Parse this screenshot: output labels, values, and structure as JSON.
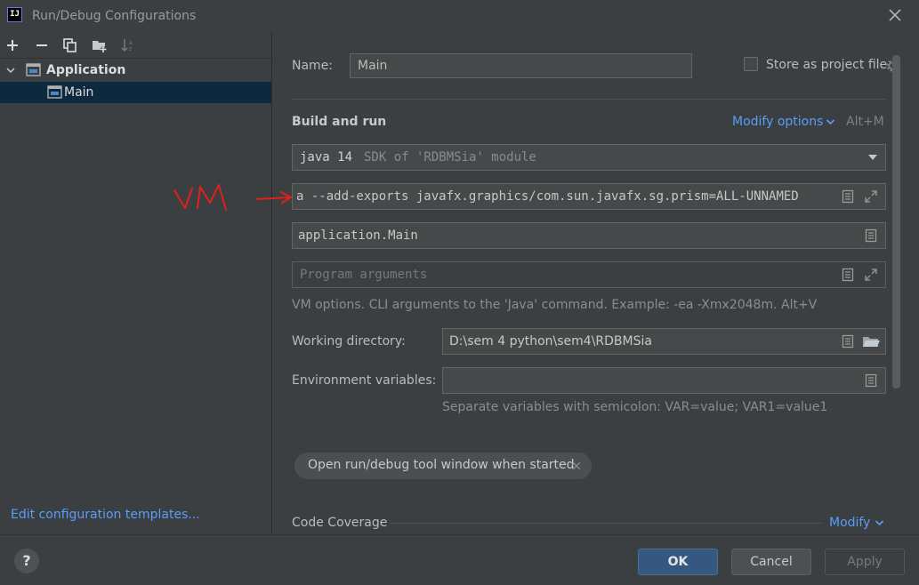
{
  "window": {
    "title": "Run/Debug Configurations",
    "app_icon_text": "IJ"
  },
  "tree": {
    "root_label": "Application",
    "child_label": "Main"
  },
  "left_footer": {
    "edit_templates": "Edit configuration templates..."
  },
  "form": {
    "name_label": "Name:",
    "name_value": "Main",
    "store_label": "Store as project file",
    "section_title": "Build and run",
    "modify_options": "Modify options",
    "modify_shortcut": "Alt+M",
    "sdk_main": "java 14",
    "sdk_detail": "SDK of 'RDBMSia' module",
    "vm_options_value": "a --add-exports javafx.graphics/com.sun.javafx.sg.prism=ALL-UNNAMED",
    "main_class_value": "application.Main",
    "program_args_placeholder": "Program arguments",
    "vm_hint": "VM options. CLI arguments to the 'Java' command. Example: -ea -Xmx2048m. Alt+V",
    "workdir_label": "Working directory:",
    "workdir_value": "D:\\sem 4 python\\sem4\\RDBMSia",
    "env_label": "Environment variables:",
    "env_value": "",
    "env_hint": "Separate variables with semicolon: VAR=value; VAR1=value1",
    "chip_label": "Open run/debug tool window when started",
    "coverage_label": "Code Coverage",
    "coverage_modify": "Modify"
  },
  "annotation": {
    "text": "VM"
  },
  "buttons": {
    "ok": "OK",
    "cancel": "Cancel",
    "apply": "Apply",
    "help": "?"
  },
  "colors": {
    "accent": "#589df6",
    "ok_button": "#365880",
    "annotation": "#e0201a",
    "selection": "#0d293e"
  }
}
